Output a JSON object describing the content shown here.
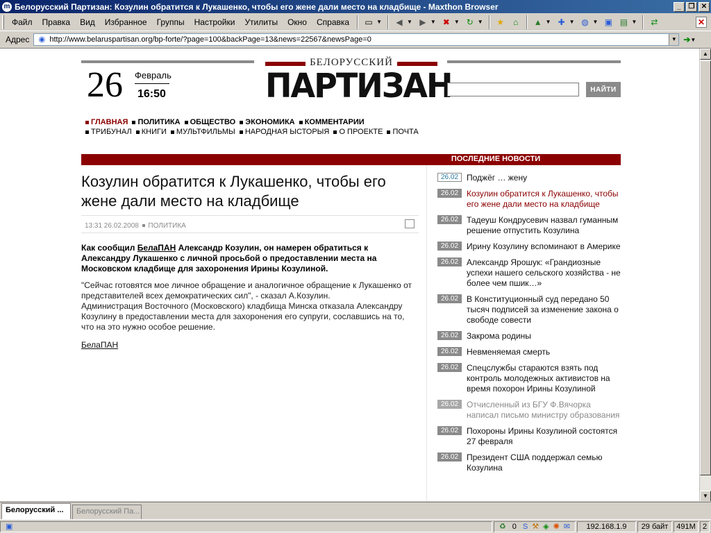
{
  "window": {
    "title": "Белорусский Партизан: Козулин обратится к Лукашенко, чтобы его жене дали место на кладбище - Maxthon Browser",
    "app_icon": "m",
    "minimize": "_",
    "maximize": "❐",
    "close": "✕"
  },
  "menu": {
    "items": [
      "Файл",
      "Правка",
      "Вид",
      "Избранное",
      "Группы",
      "Настройки",
      "Утилиты",
      "Окно",
      "Справка"
    ]
  },
  "address": {
    "label": "Адрес",
    "url": "http://www.belaruspartisan.org/bp-forte/?page=100&backPage=13&news=22567&newsPage=0"
  },
  "header": {
    "day": "26",
    "month": "Февраль",
    "time": "16:50",
    "logo_sub": "БЕЛОРУССКИЙ",
    "logo_main": "ПАРТИЗАН",
    "search_placeholder": "",
    "search_button": "НАЙТИ"
  },
  "nav": {
    "primary": [
      "ГЛАВНАЯ",
      "ПОЛИТИКА",
      "ОБЩЕСТВО",
      "ЭКОНОМИКА",
      "КОММЕНТАРИИ"
    ],
    "secondary": [
      "ТРИБУНАЛ",
      "КНИГИ",
      "МУЛЬТФИЛЬМЫ",
      "НАРОДНАЯ ЫСТОРЫЯ",
      "О ПРОЕКТЕ",
      "ПОЧТА"
    ]
  },
  "news_header": "ПОСЛЕДНИЕ НОВОСТИ",
  "article": {
    "headline": "Козулин обратится к Лукашенко, чтобы его жене дали место на кладбище",
    "meta_time": "13:31 26.02.2008",
    "meta_category": "ПОЛИТИКА",
    "lead_prefix": "Как сообщил ",
    "lead_source": "БелаПАН",
    "lead_text": " Александр Козулин, он намерен обратиться к Александру Лукашенко с личной просьбой о предоставлении места на Московском кладбище для захоронения Ирины Козулиной.",
    "body_p1": "\"Сейчас готовятся мое личное обращение и аналогичное обращение к Лукашенко от представителей всех демократических сил\", - сказал А.Козулин.",
    "body_p2": "Администрация Восточного (Московского) кладбища Минска отказала Александру Козулину в предоставлении места для захоронения его супруги, сославшись на то, что на это нужно особое решение.",
    "source_link": "БелаПАН"
  },
  "news": [
    {
      "date": "26.02",
      "title": "Поджёг … жену",
      "state": "current"
    },
    {
      "date": "26.02",
      "title": "Козулин обратится к Лукашенко, чтобы его жене дали место на кладбище",
      "state": "highlight"
    },
    {
      "date": "26.02",
      "title": "Тадеуш Кондрусевич назвал гуманным решение отпустить Козулина",
      "state": "normal"
    },
    {
      "date": "26.02",
      "title": "Ирину Козулину вспоминают в Америке",
      "state": "normal"
    },
    {
      "date": "26.02",
      "title": "Александр Ярошук: «Грандиозные успехи нашего сельского хозяйства - не более чем пшик…»",
      "state": "normal"
    },
    {
      "date": "26.02",
      "title": "В Конституционный суд передано 50 тысяч подписей за изменение закона о свободе совести",
      "state": "normal"
    },
    {
      "date": "26.02",
      "title": "Закрома родины",
      "state": "normal"
    },
    {
      "date": "26.02",
      "title": "Невменяемая смерть",
      "state": "normal"
    },
    {
      "date": "26.02",
      "title": "Спецслужбы стараются взять под контроль молодежных активистов на время похорон Ирины Козулиной",
      "state": "normal"
    },
    {
      "date": "26.02",
      "title": "Отчисленный из БГУ Ф.Вячорка написал письмо министру образования",
      "state": "faded"
    },
    {
      "date": "26.02",
      "title": "Похороны Ирины Козулиной состоятся 27 февраля",
      "state": "normal"
    },
    {
      "date": "26.02",
      "title": "Президент США поддержал семью Козулина",
      "state": "normal"
    }
  ],
  "tabs": [
    {
      "label": "Белорусский ...",
      "state": "active"
    },
    {
      "label": "Белорусский Па...",
      "state": "inactive"
    }
  ],
  "status": {
    "count": "0",
    "ip": "192.168.1.9",
    "bytes": "29 байт",
    "memory": "491M",
    "pages": "2"
  }
}
